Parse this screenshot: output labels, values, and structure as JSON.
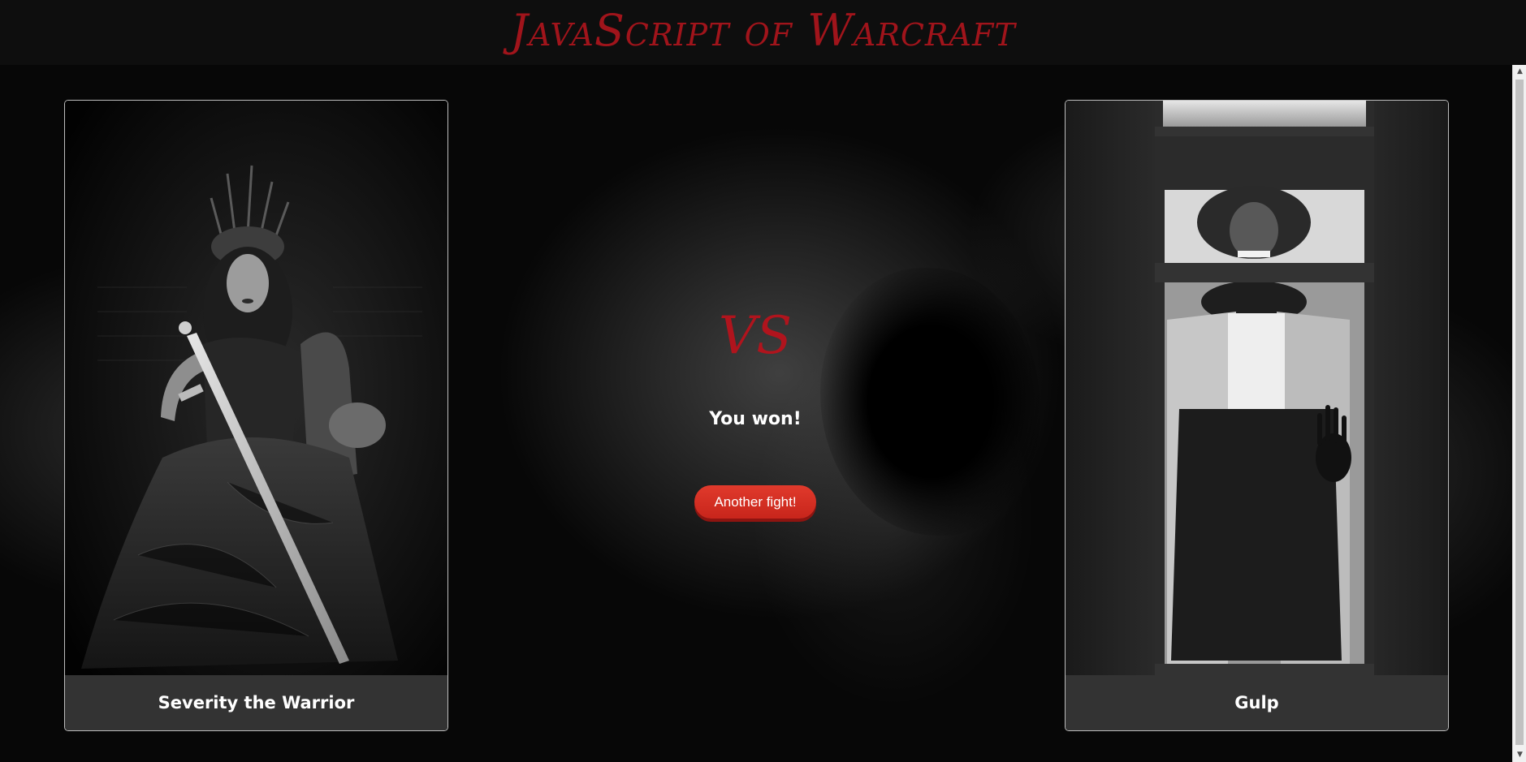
{
  "header": {
    "title": "JavaScript of Warcraft"
  },
  "fighters": {
    "left": {
      "name": "Severity the Warrior",
      "image": "warrior-queen-portrait"
    },
    "right": {
      "name": "Gulp",
      "image": "clown-at-window-portrait"
    }
  },
  "battle": {
    "vs_label": "VS",
    "result": "You won!",
    "another_fight_label": "Another fight!"
  },
  "colors": {
    "title_red": "#a0141b",
    "button_red": "#d42f23",
    "card_footer": "#333333"
  }
}
